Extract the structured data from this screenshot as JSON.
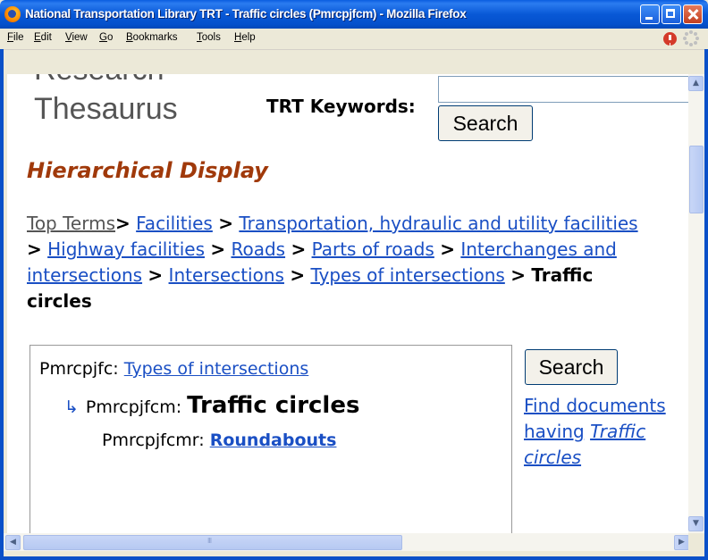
{
  "window": {
    "title": "National Transportation Library TRT - Traffic circles (Pmrcpjfcm) - Mozilla Firefox"
  },
  "menu": {
    "items": [
      "File",
      "Edit",
      "View",
      "Go",
      "Bookmarks",
      "Tools",
      "Help"
    ]
  },
  "page": {
    "logo_top_partial": "Research",
    "logo_main": "Thesaurus",
    "keywords_label": "TRT Keywords:",
    "keywords_value": "",
    "search_button": "Search",
    "hierarchy_title": "Hierarchical Display",
    "breadcrumb": {
      "top": "Top Terms",
      "links": [
        "Facilities",
        "Transportation, hydraulic and utility facilities",
        "Highway facilities",
        "Roads",
        "Parts of roads",
        "Interchanges and intersections",
        "Intersections",
        "Types of intersections"
      ],
      "current": "Traffic circles",
      "separator": ">"
    },
    "tree": {
      "parent_code": "Pmrcpjfc:",
      "parent_label": "Types of intersections",
      "current_code": "Pmrcpjfcm:",
      "current_label": "Traffic circles",
      "child_code": "Pmrcpjfcmr:",
      "child_label": "Roundabouts"
    },
    "side": {
      "search_button": "Search",
      "find_prefix": "Find documents having",
      "find_term": "Traffic circles"
    }
  },
  "colors": {
    "link": "#1a4fc4",
    "heading": "#a0390a",
    "titlebar": "#0858d6"
  }
}
